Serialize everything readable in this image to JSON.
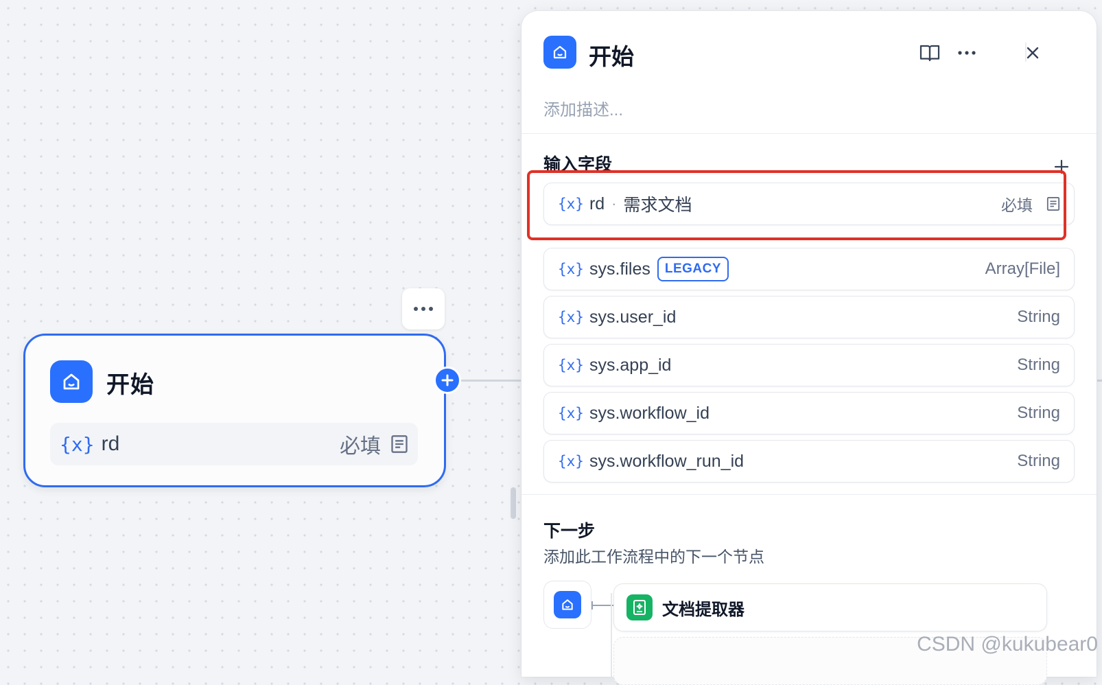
{
  "canvas": {
    "start_node": {
      "title": "开始",
      "variable": {
        "brace": "{x}",
        "name": "rd",
        "required": "必填"
      }
    }
  },
  "panel": {
    "title": "开始",
    "description_placeholder": "添加描述...",
    "input_fields": {
      "title": "输入字段",
      "items": [
        {
          "brace": "{x}",
          "name": "rd",
          "separator": "·",
          "label": "需求文档",
          "required": "必填"
        },
        {
          "brace": "{x}",
          "name": "sys.files",
          "badge": "LEGACY",
          "type": "Array[File]"
        },
        {
          "brace": "{x}",
          "name": "sys.user_id",
          "type": "String"
        },
        {
          "brace": "{x}",
          "name": "sys.app_id",
          "type": "String"
        },
        {
          "brace": "{x}",
          "name": "sys.workflow_id",
          "type": "String"
        },
        {
          "brace": "{x}",
          "name": "sys.workflow_run_id",
          "type": "String"
        }
      ]
    },
    "next_step": {
      "title": "下一步",
      "subtitle": "添加此工作流程中的下一个节点",
      "nodes": [
        {
          "label": "文档提取器",
          "icon": "document-extractor-icon"
        }
      ]
    }
  },
  "watermark": "CSDN @kukubear0",
  "colors": {
    "accent": "#2970ff",
    "highlight": "#e03127",
    "doc_node": "#16b364"
  }
}
